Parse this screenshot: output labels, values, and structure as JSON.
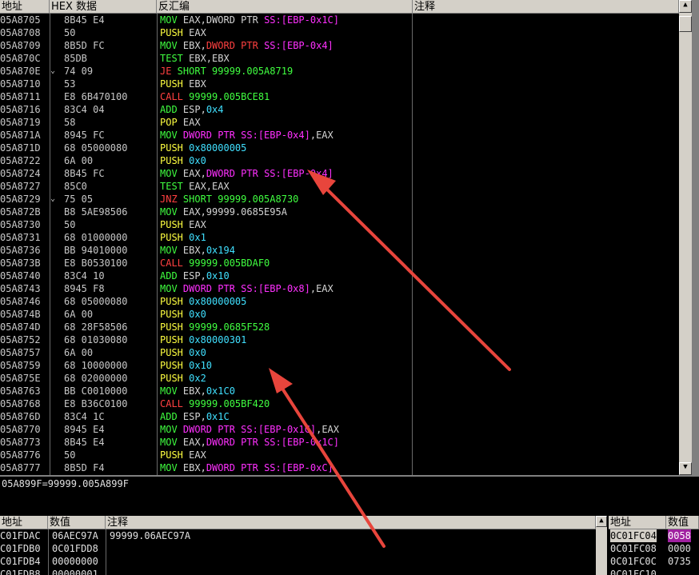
{
  "headers": {
    "addr": "地址",
    "hex": "HEX 数据",
    "dis": "反汇编",
    "comment": "注释"
  },
  "rows": [
    {
      "addr": "05A8705",
      "hex": "8B45 E4",
      "j": "",
      "d": [
        [
          "MOV",
          "g"
        ],
        [
          " EAX,",
          ""
        ],
        [
          "DWORD PTR",
          ""
        ],
        [
          " SS:[EBP-0x1C]",
          "m"
        ]
      ]
    },
    {
      "addr": "05A8708",
      "hex": "50",
      "j": "",
      "d": [
        [
          "PUSH",
          "y"
        ],
        [
          " EAX",
          ""
        ]
      ]
    },
    {
      "addr": "05A8709",
      "hex": "8B5D FC",
      "j": "",
      "d": [
        [
          "MOV",
          "g"
        ],
        [
          " EBX,",
          ""
        ],
        [
          "DWORD PTR",
          "c"
        ],
        [
          " SS:[EBP-0x4]",
          "m"
        ]
      ]
    },
    {
      "addr": "05A870C",
      "hex": "85DB",
      "j": "",
      "d": [
        [
          "TEST",
          "g"
        ],
        [
          " EBX,EBX",
          ""
        ]
      ]
    },
    {
      "addr": "05A870E",
      "hex": "74 09",
      "j": "⌄",
      "d": [
        [
          "JE",
          "c"
        ],
        [
          " SHORT 99999.005A8719",
          "g"
        ]
      ]
    },
    {
      "addr": "05A8710",
      "hex": "53",
      "j": "",
      "d": [
        [
          "PUSH",
          "y"
        ],
        [
          " EBX",
          ""
        ]
      ]
    },
    {
      "addr": "05A8711",
      "hex": "E8 6B470100",
      "j": "",
      "d": [
        [
          "CALL",
          "c"
        ],
        [
          " 99999.005BCE81",
          "g"
        ]
      ]
    },
    {
      "addr": "05A8716",
      "hex": "83C4 04",
      "j": "",
      "d": [
        [
          "ADD",
          "g"
        ],
        [
          " ESP,",
          ""
        ],
        [
          "0x4",
          "n"
        ]
      ]
    },
    {
      "addr": "05A8719",
      "hex": "58",
      "j": "",
      "d": [
        [
          "POP",
          "y"
        ],
        [
          " EAX",
          ""
        ]
      ]
    },
    {
      "addr": "05A871A",
      "hex": "8945 FC",
      "j": "",
      "d": [
        [
          "MOV",
          "g"
        ],
        [
          " DWORD PTR",
          "m"
        ],
        [
          " SS:[EBP-0x4]",
          "m"
        ],
        [
          ",EAX",
          ""
        ]
      ]
    },
    {
      "addr": "05A871D",
      "hex": "68 05000080",
      "j": "",
      "d": [
        [
          "PUSH",
          "y"
        ],
        [
          " 0x80000005",
          "n"
        ]
      ]
    },
    {
      "addr": "05A8722",
      "hex": "6A 00",
      "j": "",
      "d": [
        [
          "PUSH",
          "y"
        ],
        [
          " 0x0",
          "n"
        ]
      ]
    },
    {
      "addr": "05A8724",
      "hex": "8B45 FC",
      "j": "",
      "d": [
        [
          "MOV",
          "g"
        ],
        [
          " EAX,",
          ""
        ],
        [
          "DWORD PTR",
          "m"
        ],
        [
          " SS:[EBP-0x4]",
          "m"
        ]
      ]
    },
    {
      "addr": "05A8727",
      "hex": "85C0",
      "j": "",
      "d": [
        [
          "TEST",
          "g"
        ],
        [
          " EAX,EAX",
          ""
        ]
      ]
    },
    {
      "addr": "05A8729",
      "hex": "75 05",
      "j": "⌄",
      "d": [
        [
          "JNZ",
          "c"
        ],
        [
          " SHORT 99999.005A8730",
          "g"
        ]
      ]
    },
    {
      "addr": "05A872B",
      "hex": "B8 5AE98506",
      "j": "",
      "d": [
        [
          "MOV",
          "g"
        ],
        [
          " EAX,99999.0685E95A",
          ""
        ]
      ]
    },
    {
      "addr": "05A8730",
      "hex": "50",
      "j": "",
      "d": [
        [
          "PUSH",
          "y"
        ],
        [
          " EAX",
          ""
        ]
      ]
    },
    {
      "addr": "05A8731",
      "hex": "68 01000000",
      "j": "",
      "d": [
        [
          "PUSH",
          "y"
        ],
        [
          " 0x1",
          "n"
        ]
      ]
    },
    {
      "addr": "05A8736",
      "hex": "BB 94010000",
      "j": "",
      "d": [
        [
          "MOV",
          "g"
        ],
        [
          " EBX,",
          ""
        ],
        [
          "0x194",
          "n"
        ]
      ]
    },
    {
      "addr": "05A873B",
      "hex": "E8 B0530100",
      "j": "",
      "d": [
        [
          "CALL",
          "c"
        ],
        [
          " 99999.005BDAF0",
          "g"
        ]
      ]
    },
    {
      "addr": "05A8740",
      "hex": "83C4 10",
      "j": "",
      "d": [
        [
          "ADD",
          "g"
        ],
        [
          " ESP,",
          ""
        ],
        [
          "0x10",
          "n"
        ]
      ]
    },
    {
      "addr": "05A8743",
      "hex": "8945 F8",
      "j": "",
      "d": [
        [
          "MOV",
          "g"
        ],
        [
          " DWORD PTR",
          "m"
        ],
        [
          " SS:[EBP-0x8]",
          "m"
        ],
        [
          ",EAX",
          ""
        ]
      ]
    },
    {
      "addr": "05A8746",
      "hex": "68 05000080",
      "j": "",
      "d": [
        [
          "PUSH",
          "y"
        ],
        [
          " 0x80000005",
          "n"
        ]
      ]
    },
    {
      "addr": "05A874B",
      "hex": "6A 00",
      "j": "",
      "d": [
        [
          "PUSH",
          "y"
        ],
        [
          " 0x0",
          "n"
        ]
      ]
    },
    {
      "addr": "05A874D",
      "hex": "68 28F58506",
      "j": "",
      "d": [
        [
          "PUSH",
          "y"
        ],
        [
          " 99999.0685F528",
          "g"
        ]
      ]
    },
    {
      "addr": "05A8752",
      "hex": "68 01030080",
      "j": "",
      "d": [
        [
          "PUSH",
          "y"
        ],
        [
          " 0x80000301",
          "n"
        ]
      ]
    },
    {
      "addr": "05A8757",
      "hex": "6A 00",
      "j": "",
      "d": [
        [
          "PUSH",
          "y"
        ],
        [
          " 0x0",
          "n"
        ]
      ]
    },
    {
      "addr": "05A8759",
      "hex": "68 10000000",
      "j": "",
      "d": [
        [
          "PUSH",
          "y"
        ],
        [
          " 0x10",
          "n"
        ]
      ]
    },
    {
      "addr": "05A875E",
      "hex": "68 02000000",
      "j": "",
      "d": [
        [
          "PUSH",
          "y"
        ],
        [
          " 0x2",
          "n"
        ]
      ]
    },
    {
      "addr": "05A8763",
      "hex": "BB C0010000",
      "j": "",
      "d": [
        [
          "MOV",
          "g"
        ],
        [
          " EBX,",
          ""
        ],
        [
          "0x1C0",
          "n"
        ]
      ]
    },
    {
      "addr": "05A8768",
      "hex": "E8 B36C0100",
      "j": "",
      "d": [
        [
          "CALL",
          "c"
        ],
        [
          " 99999.005BF420",
          "g"
        ]
      ]
    },
    {
      "addr": "05A876D",
      "hex": "83C4 1C",
      "j": "",
      "d": [
        [
          "ADD",
          "g"
        ],
        [
          " ESP,",
          ""
        ],
        [
          "0x1C",
          "n"
        ]
      ]
    },
    {
      "addr": "05A8770",
      "hex": "8945 E4",
      "j": "",
      "d": [
        [
          "MOV",
          "g"
        ],
        [
          " DWORD PTR",
          "m"
        ],
        [
          " SS:[EBP-0x1C]",
          "m"
        ],
        [
          ",EAX",
          ""
        ]
      ]
    },
    {
      "addr": "05A8773",
      "hex": "8B45 E4",
      "j": "",
      "d": [
        [
          "MOV",
          "g"
        ],
        [
          " EAX,",
          ""
        ],
        [
          "DWORD PTR",
          "m"
        ],
        [
          " SS:[EBP-0x1C]",
          "m"
        ]
      ]
    },
    {
      "addr": "05A8776",
      "hex": "50",
      "j": "",
      "d": [
        [
          "PUSH",
          "y"
        ],
        [
          " EAX",
          ""
        ]
      ]
    },
    {
      "addr": "05A8777",
      "hex": "8B5D F4",
      "j": "",
      "d": [
        [
          "MOV",
          "g"
        ],
        [
          " EBX,",
          ""
        ],
        [
          "DWORD PTR",
          "m"
        ],
        [
          " SS:[EBP-0xC]",
          "m"
        ]
      ]
    }
  ],
  "info_line": "05A899F=99999.005A899F",
  "stack_headers": {
    "addr": "地址",
    "value": "数值",
    "comment": "注释"
  },
  "stack_rows": [
    {
      "addr": "C01FDAC",
      "value": "06AEC97A",
      "comment": "99999.06AEC97A"
    },
    {
      "addr": "C01FDB0",
      "value": "0C01FDD8",
      "comment": ""
    },
    {
      "addr": "C01FDB4",
      "value": "00000000",
      "comment": ""
    },
    {
      "addr": "C01FDB8",
      "value": "00000001",
      "comment": ""
    }
  ],
  "dump_headers": {
    "addr": "地址",
    "value": "数值"
  },
  "dump_rows": [
    {
      "addr": "0C01FC04",
      "value": "0058"
    },
    {
      "addr": "0C01FC08",
      "value": "0000"
    },
    {
      "addr": "0C01FC0C",
      "value": "0735"
    },
    {
      "addr": "0C01FC10",
      "value": ""
    }
  ],
  "colors": {
    "yellow": "#ffff40",
    "red": "#ff4040",
    "magenta": "#ff30ff",
    "green": "#40ff40",
    "cyan": "#40e0ff",
    "arrow": "#e8453c"
  }
}
